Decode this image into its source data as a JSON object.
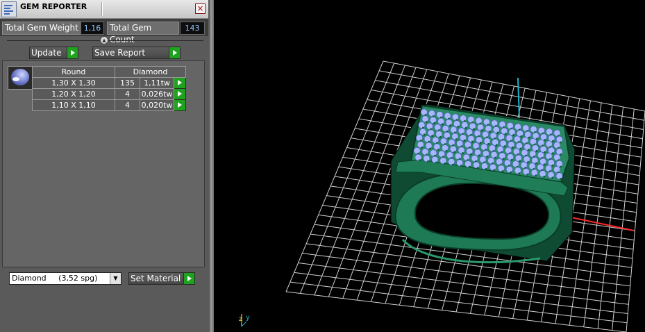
{
  "window": {
    "title": "GEM REPORTER",
    "close_label": "×"
  },
  "stats": {
    "weight_label": "Total Gem Weight",
    "weight_value": "1,16",
    "count_label": "Total Gem Count",
    "count_value": "143"
  },
  "buttons": {
    "update": "Update",
    "save_report": "Save Report",
    "set_material": "Set Material"
  },
  "table": {
    "headers": [
      "Round",
      "Diamond"
    ],
    "rows": [
      {
        "size": "1,30 X 1,30",
        "count": "135",
        "weight": "1,11tw"
      },
      {
        "size": "1,20 X 1,20",
        "count": "4",
        "weight": "0,026tw"
      },
      {
        "size": "1,10 X 1,10",
        "count": "4",
        "weight": "0,020tw"
      }
    ]
  },
  "material": {
    "selected": "Diamond     (3,52 spg)"
  },
  "viewport": {
    "axis_label_z": "z",
    "axis_label_y": "y"
  },
  "colors": {
    "ring_metal": "#1f7d57",
    "gem_stone": "#a7b6ff",
    "grid": "#d0d0d0",
    "axis_x": "#ff2a2a",
    "axis_y": "#1fb6c6",
    "go_green": "#1fa31f"
  }
}
